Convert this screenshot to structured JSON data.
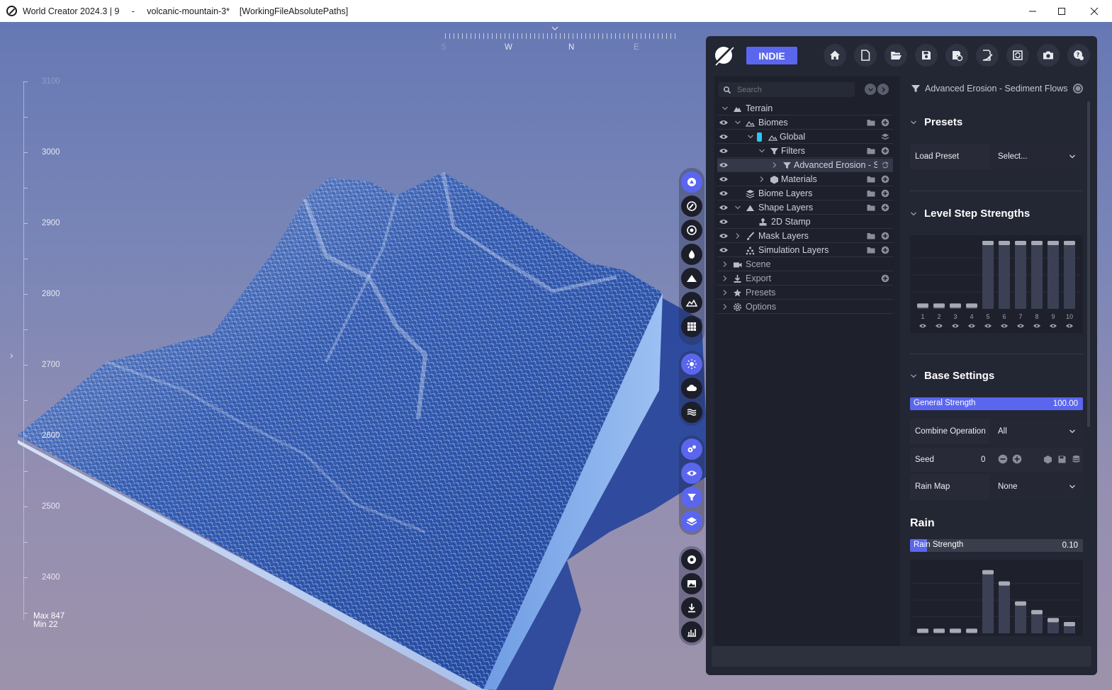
{
  "window": {
    "title": "World Creator 2024.3 | 9     -     volcanic-mountain-3*    [WorkingFileAbsolutePaths]",
    "controls": [
      "minimize",
      "maximize",
      "close"
    ]
  },
  "viewport": {
    "compass": [
      "S",
      "W",
      "N",
      "E"
    ],
    "ruler_labels": [
      "3000",
      "2900",
      "2800",
      "2700",
      "2600",
      "2500",
      "2400"
    ],
    "ruler_top_label": "3100",
    "max_label": "Max 847",
    "min_label": "Min 22"
  },
  "panel": {
    "badge": "INDIE",
    "search_placeholder": "Search",
    "tree": [
      {
        "label": "Terrain"
      },
      {
        "label": "Biomes"
      },
      {
        "label": "Global"
      },
      {
        "label": "Filters"
      },
      {
        "label": "Advanced Erosion - Se"
      },
      {
        "label": "Materials"
      },
      {
        "label": "Biome Layers"
      },
      {
        "label": "Shape Layers"
      },
      {
        "label": "2D Stamp"
      },
      {
        "label": "Mask Layers"
      },
      {
        "label": "Simulation Layers"
      },
      {
        "label": "Scene"
      },
      {
        "label": "Export"
      },
      {
        "label": "Presets"
      },
      {
        "label": "Options"
      }
    ],
    "props": {
      "header": "Advanced Erosion - Sediment Flows Se",
      "presets_title": "Presets",
      "load_preset_label": "Load Preset",
      "load_preset_value": "Select...",
      "level_step_title": "Level Step Strengths",
      "level_steps": {
        "labels": [
          "1",
          "2",
          "3",
          "4",
          "5",
          "6",
          "7",
          "8",
          "9",
          "10"
        ],
        "values": [
          0.08,
          0.08,
          0.08,
          0.08,
          1.0,
          1.0,
          1.0,
          1.0,
          1.0,
          1.0
        ]
      },
      "base_settings_title": "Base Settings",
      "general_strength_label": "General Strength",
      "general_strength_value": "100.00",
      "general_strength_fraction": 1.0,
      "combine_label": "Combine Operation",
      "combine_value": "All",
      "seed_label": "Seed",
      "seed_value": "0",
      "rain_map_label": "Rain Map",
      "rain_map_value": "None",
      "rain_title": "Rain",
      "rain_strength_label": "Rain Strength",
      "rain_strength_value": "0.10",
      "rain_strength_fraction": 0.1,
      "rain_steps": {
        "values": [
          0.07,
          0.07,
          0.07,
          0.07,
          0.95,
          0.78,
          0.48,
          0.35,
          0.23,
          0.17
        ]
      }
    }
  },
  "colors": {
    "accent": "#5b66ee",
    "panel_bg": "#232633",
    "tree_bg": "#1e212c",
    "terrain_blue": "#2d54a8",
    "terrain_highlight": "#dfe6f4",
    "wall_light": "#b9cdef"
  }
}
